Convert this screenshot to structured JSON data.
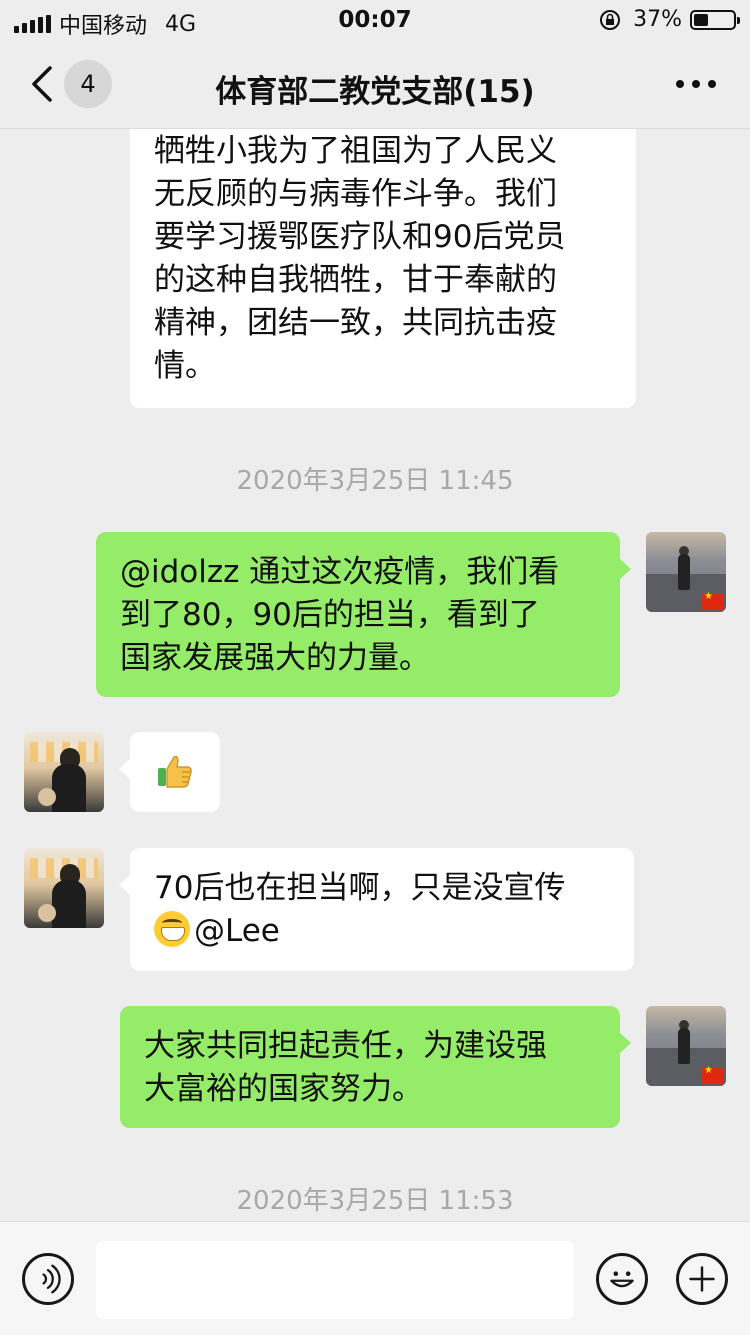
{
  "status_bar": {
    "carrier": "中国移动",
    "network": "4G",
    "time": "00:07",
    "battery": "37%",
    "battery_level": 0.37
  },
  "nav": {
    "unread_count": "4",
    "title": "体育部二教党支部(15)"
  },
  "messages": [
    {
      "side": "left",
      "lines": [
        "牺牲小我为了祖国为了人民义",
        "无反顾的与病毒作斗争。我们",
        "要学习援鄂医疗队和90后党员",
        "的这种自我牺牲，甘于奉献的",
        "精神，团结一致，共同抗击疫",
        "情。"
      ]
    },
    {
      "timestamp": "2020年3月25日 11:45"
    },
    {
      "side": "right",
      "lines": [
        "@idolzz 通过这次疫情，我们看",
        "到了80，90后的担当，看到了",
        "国家发展强大的力量。"
      ]
    },
    {
      "side": "left",
      "emoji": "thumbs-up-icon"
    },
    {
      "side": "left",
      "lines": [
        "70后也在担当啊，只是没宣传"
      ],
      "mention": "@Lee",
      "emoji": "grin-icon"
    },
    {
      "side": "right",
      "lines": [
        "大家共同担起责任，为建设强",
        "大富裕的国家努力。"
      ]
    },
    {
      "timestamp": "2020年3月25日 11:53"
    }
  ],
  "input": {
    "placeholder": "",
    "value": ""
  },
  "colors": {
    "background": "#ededed",
    "own_bubble": "#95ec69",
    "other_bubble": "#ffffff",
    "timestamp": "#a8a8a8"
  },
  "icons": [
    "back-icon",
    "more-icon",
    "voice-icon",
    "emoji-icon",
    "plus-icon"
  ]
}
